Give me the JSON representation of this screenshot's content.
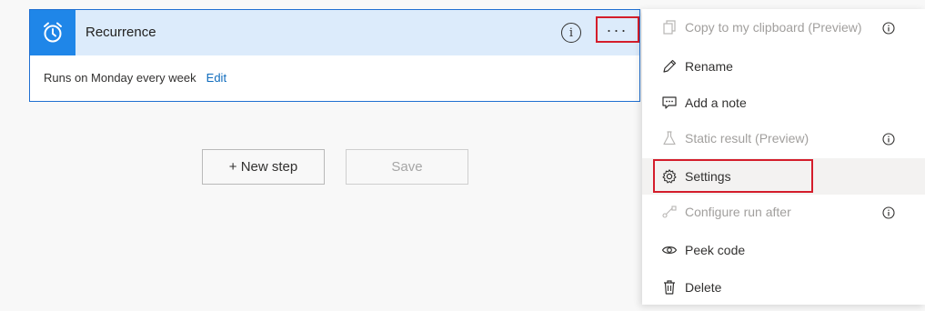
{
  "trigger_card": {
    "title": "Recurrence",
    "icon": "alarm-clock-icon",
    "info_glyph": "i",
    "more_glyph": "...",
    "description": "Runs on Monday every week",
    "edit_label": "Edit"
  },
  "actions": {
    "new_step_label": "+ New step",
    "save_label": "Save"
  },
  "context_menu": {
    "items": [
      {
        "label": "Copy to my clipboard (Preview)",
        "icon": "copy-icon",
        "enabled": false,
        "info": true
      },
      {
        "label": "Rename",
        "icon": "pencil-icon",
        "enabled": true,
        "info": false
      },
      {
        "label": "Add a note",
        "icon": "comment-icon",
        "enabled": true,
        "info": false
      },
      {
        "label": "Static result (Preview)",
        "icon": "flask-icon",
        "enabled": false,
        "info": true
      },
      {
        "label": "Settings",
        "icon": "gear-icon",
        "enabled": true,
        "info": false,
        "highlighted": true
      },
      {
        "label": "Configure run after",
        "icon": "run-after-icon",
        "enabled": false,
        "info": true
      },
      {
        "label": "Peek code",
        "icon": "eye-icon",
        "enabled": true,
        "info": false
      },
      {
        "label": "Delete",
        "icon": "trash-icon",
        "enabled": true,
        "info": false
      }
    ]
  },
  "colors": {
    "accent_blue": "#1f86e8",
    "header_bg": "#dcebfb",
    "link_blue": "#0f6cbd",
    "highlight_red": "#d41d2b"
  }
}
